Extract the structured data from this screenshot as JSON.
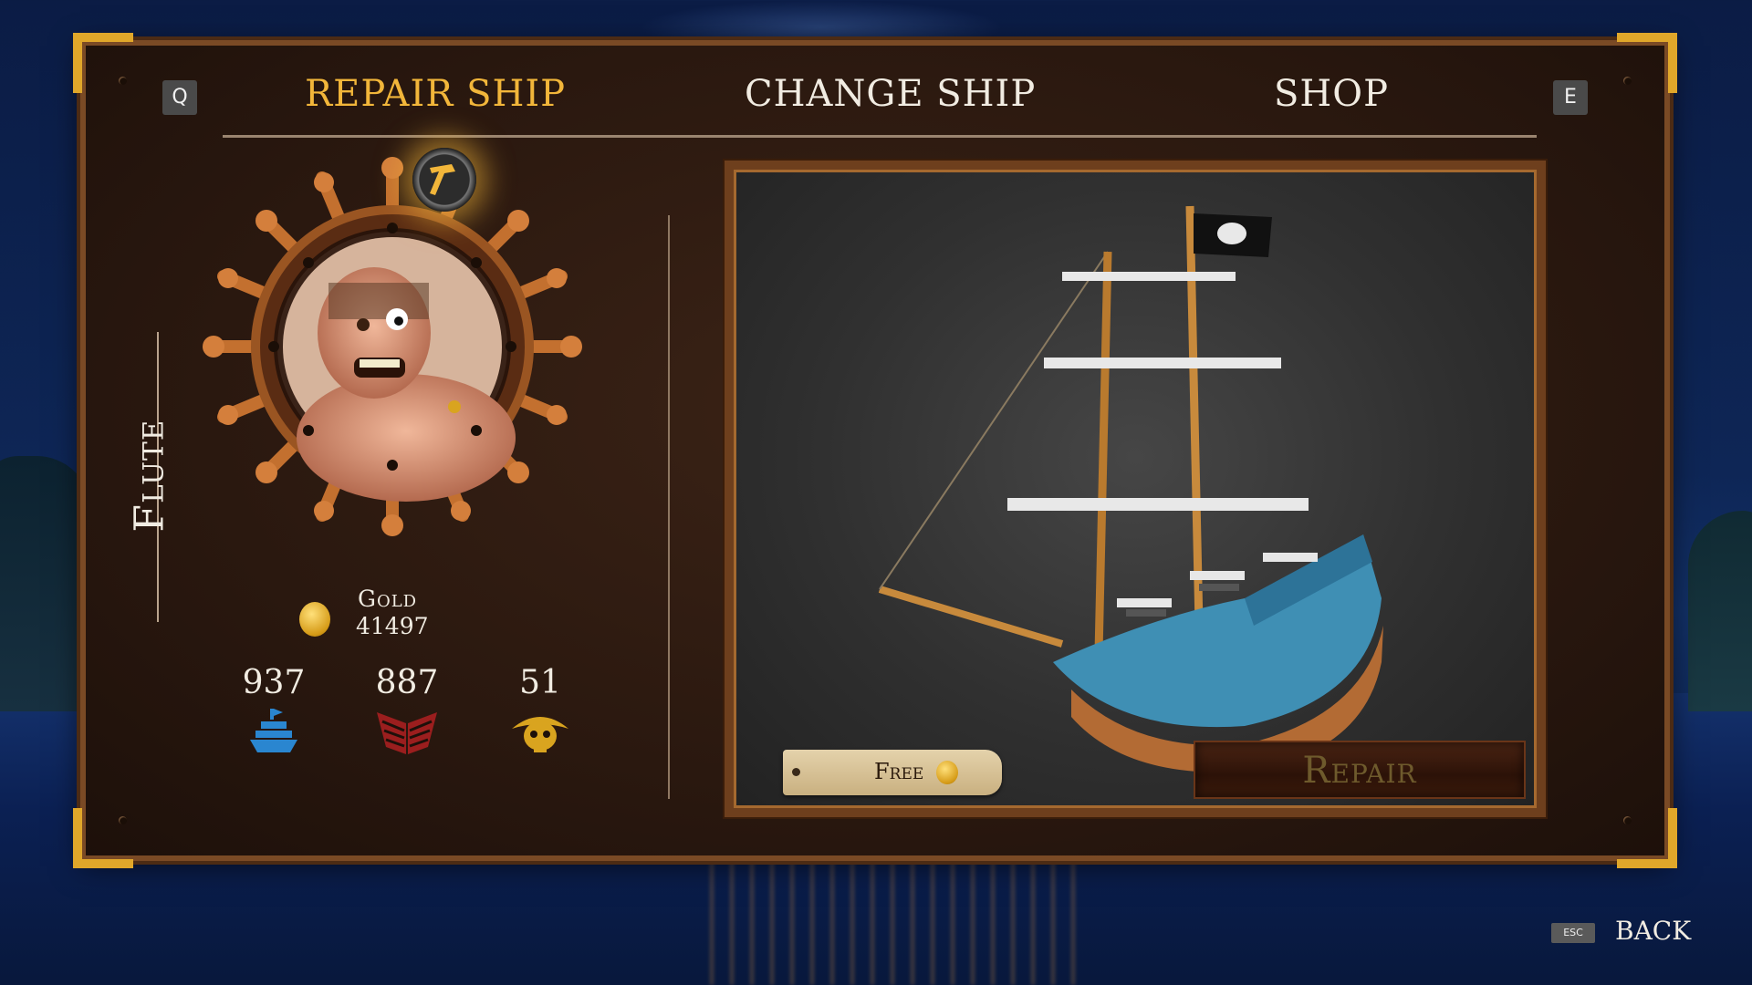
{
  "tabs": {
    "prev_key": "Q",
    "next_key": "E",
    "items": [
      {
        "label": "REPAIR SHIP",
        "active": true
      },
      {
        "label": "CHANGE SHIP",
        "active": false
      },
      {
        "label": "SHOP",
        "active": false
      }
    ]
  },
  "ship": {
    "name": "Flute"
  },
  "gold": {
    "label": "Gold",
    "value": "41497"
  },
  "stats": [
    {
      "value": "937",
      "icon": "ship-hull-icon",
      "color": "#2a86d0"
    },
    {
      "value": "887",
      "icon": "armor-plating-icon",
      "color": "#9b1e1e"
    },
    {
      "value": "51",
      "icon": "pirate-skull-icon",
      "color": "#d9a41f"
    }
  ],
  "repair": {
    "cost_label": "Free",
    "button_label": "Repair"
  },
  "footer": {
    "esc_key": "ESC",
    "back_label": "BACK"
  },
  "colors": {
    "accent": "#f2b63a",
    "frame_gold": "#e0a72a",
    "text": "#f1ece2"
  }
}
